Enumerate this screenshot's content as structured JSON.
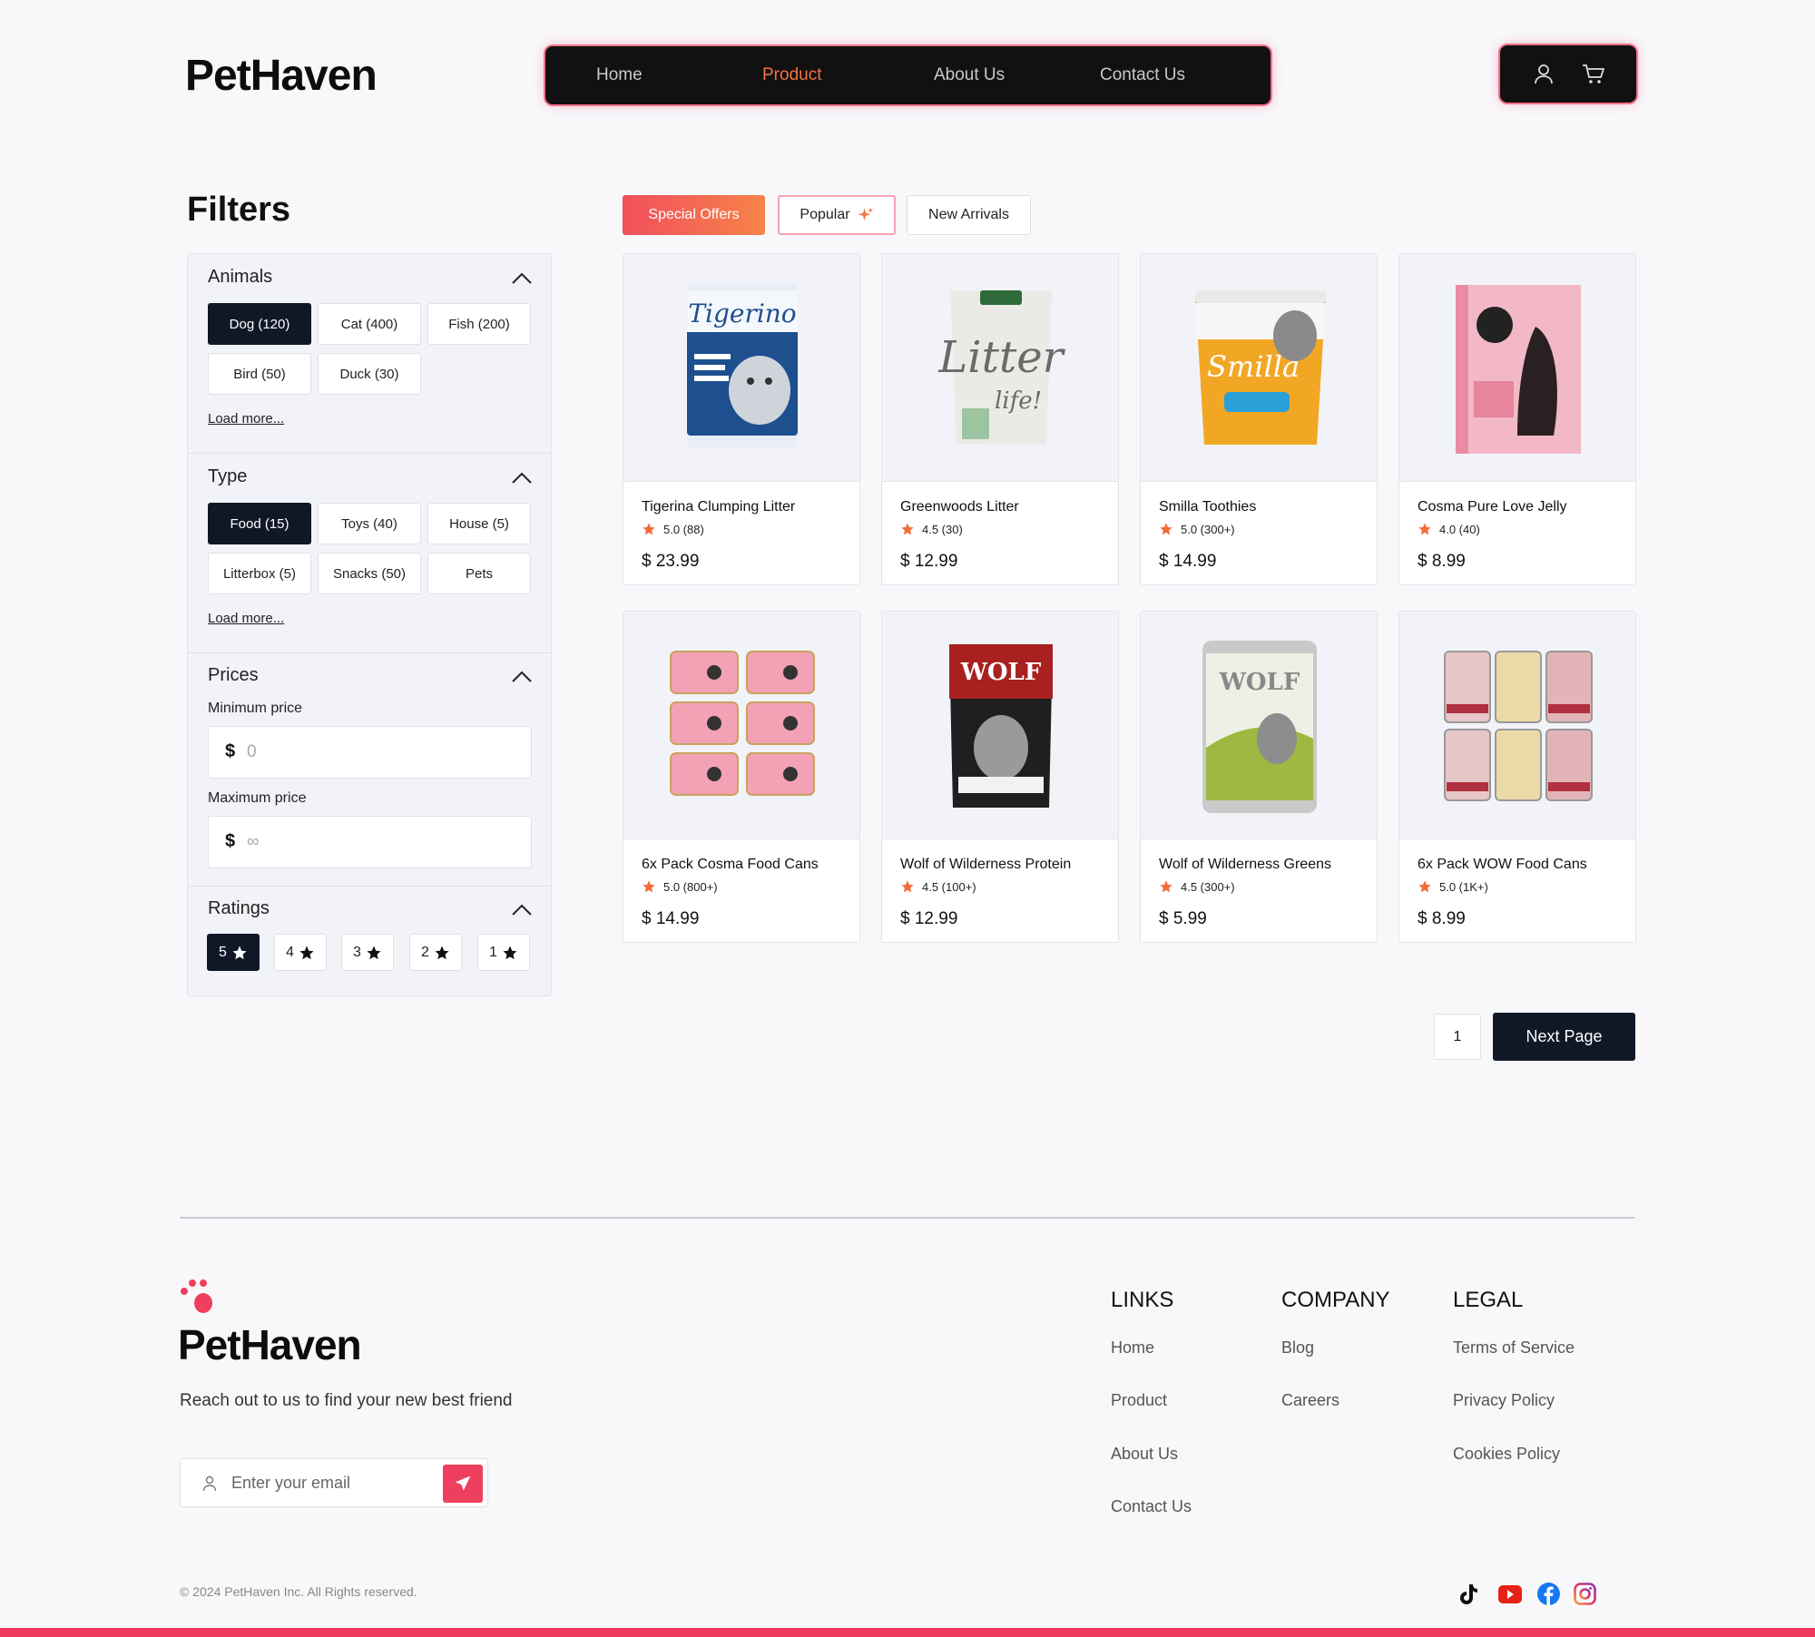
{
  "header": {
    "logo": "PetHaven",
    "nav": [
      "Home",
      "Product",
      "About Us",
      "Contact Us"
    ],
    "active_nav": "Product",
    "icons": [
      "user-icon",
      "cart-icon"
    ]
  },
  "filters": {
    "title": "Filters",
    "animals": {
      "title": "Animals",
      "chips": [
        "Dog (120)",
        "Cat (400)",
        "Fish (200)",
        "Bird (50)",
        "Duck (30)"
      ],
      "selected": "Dog (120)",
      "load_more": "Load more..."
    },
    "type": {
      "title": "Type",
      "chips": [
        "Food (15)",
        "Toys (40)",
        "House (5)",
        "Litterbox (5)",
        "Snacks (50)",
        "Pets"
      ],
      "selected": "Food (15)",
      "load_more": "Load more..."
    },
    "prices": {
      "title": "Prices",
      "min_label": "Minimum price",
      "min_currency": "$",
      "min_placeholder": "0",
      "max_label": "Maximum price",
      "max_currency": "$",
      "max_placeholder": "∞"
    },
    "ratings": {
      "title": "Ratings",
      "options": [
        "5",
        "4",
        "3",
        "2",
        "1"
      ],
      "selected": "5"
    }
  },
  "tabs": [
    "Special Offers",
    "Popular",
    "New Arrivals"
  ],
  "active_tab": "Special Offers",
  "products": [
    {
      "name": "Tigerina Clumping Litter",
      "rating": "5.0 (88)",
      "price": "$ 23.99"
    },
    {
      "name": "Greenwoods Litter",
      "rating": "4.5 (30)",
      "price": "$ 12.99"
    },
    {
      "name": "Smilla Toothies",
      "rating": "5.0 (300+)",
      "price": "$ 14.99"
    },
    {
      "name": "Cosma Pure Love Jelly",
      "rating": "4.0 (40)",
      "price": "$ 8.99"
    },
    {
      "name": "6x Pack Cosma Food Cans",
      "rating": "5.0 (800+)",
      "price": "$ 14.99"
    },
    {
      "name": "Wolf of Wilderness Protein",
      "rating": "4.5 (100+)",
      "price": "$ 12.99"
    },
    {
      "name": "Wolf of Wilderness Greens",
      "rating": "4.5 (300+)",
      "price": "$ 5.99"
    },
    {
      "name": "6x Pack WOW Food Cans",
      "rating": "5.0 (1K+)",
      "price": "$ 8.99"
    }
  ],
  "pagination": {
    "current": "1",
    "next_label": "Next Page"
  },
  "footer": {
    "logo": "PetHaven",
    "tagline": "Reach out to us to find your new best friend",
    "email_placeholder": "Enter your email",
    "links": {
      "title": "LINKS",
      "items": [
        "Home",
        "Product",
        "About Us",
        "Contact Us"
      ]
    },
    "company": {
      "title": "COMPANY",
      "items": [
        "Blog",
        "Careers"
      ]
    },
    "legal": {
      "title": "LEGAL",
      "items": [
        "Terms of Service",
        "Privacy Policy",
        "Cookies Policy"
      ]
    },
    "copyright": "© 2024 PetHaven Inc. All Rights reserved.",
    "social": [
      "tiktok-icon",
      "youtube-icon",
      "facebook-icon",
      "instagram-icon"
    ]
  },
  "colors": {
    "accent": "#f5733f",
    "brand_pink": "#ee3a5c",
    "dark": "#101828",
    "star": "#f26b3a"
  }
}
